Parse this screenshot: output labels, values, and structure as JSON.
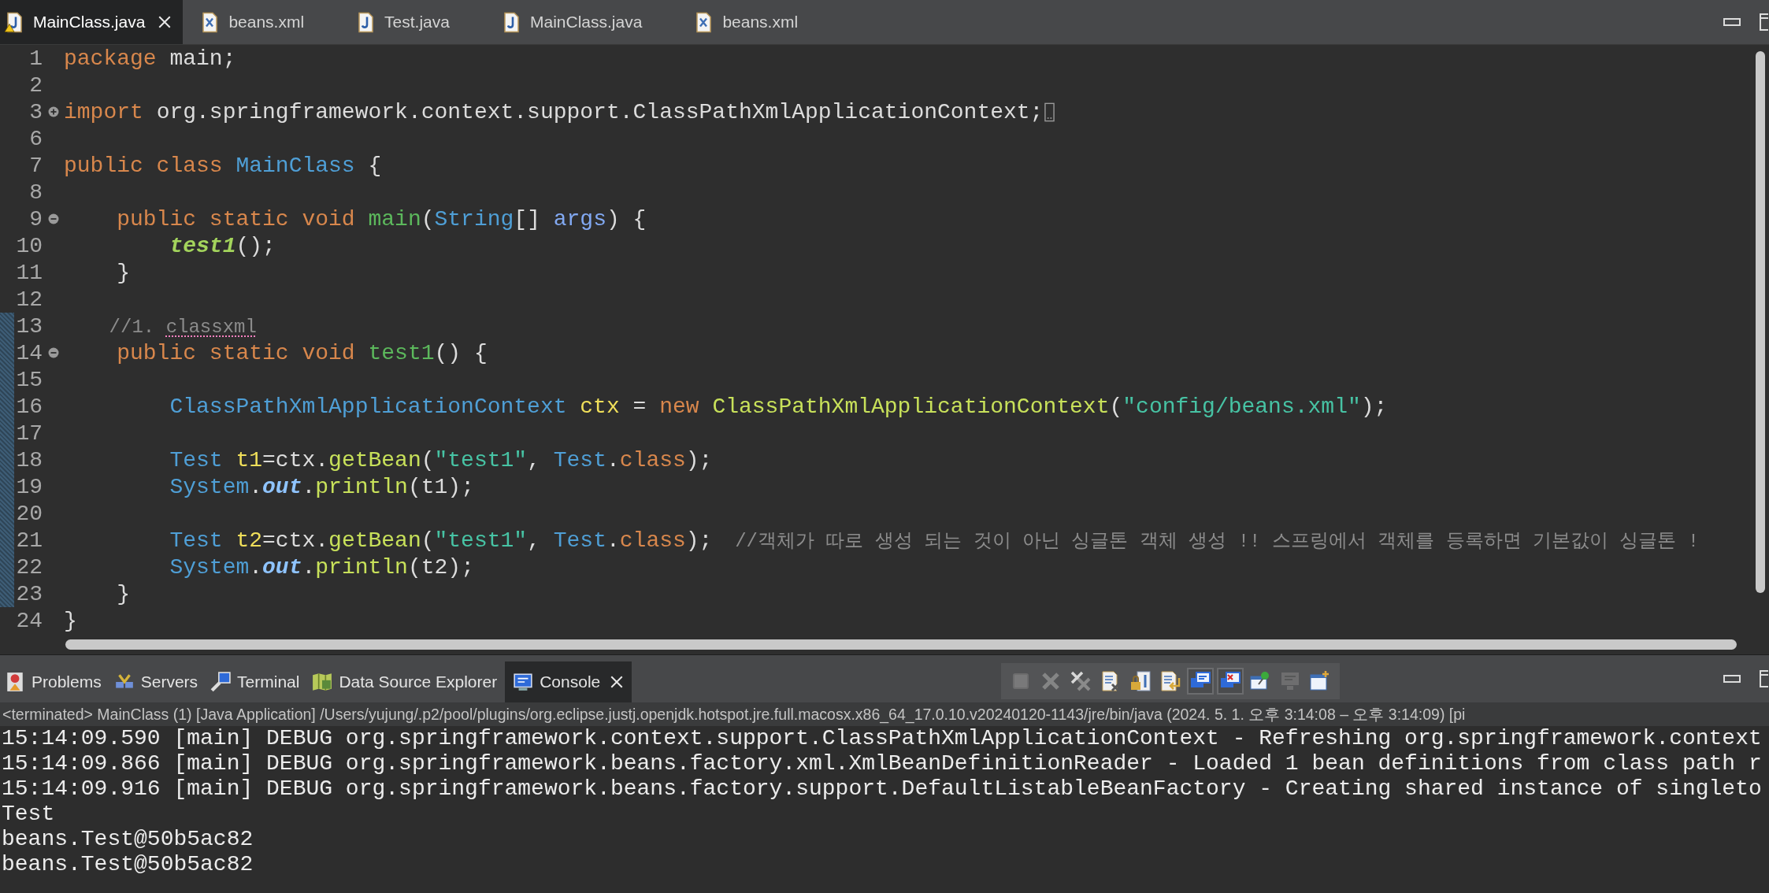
{
  "editor_tabs": [
    {
      "label": "MainClass.java",
      "kind": "java",
      "selected": true,
      "warning": true
    },
    {
      "label": "beans.xml",
      "kind": "xml",
      "selected": false,
      "warning": false
    },
    {
      "label": "Test.java",
      "kind": "java",
      "selected": false,
      "warning": false
    },
    {
      "label": "MainClass.java",
      "kind": "java",
      "selected": false,
      "warning": false
    },
    {
      "label": "beans.xml",
      "kind": "xml",
      "selected": false,
      "warning": false
    }
  ],
  "lines": [
    {
      "number": "1",
      "changed": false,
      "tokens": [
        {
          "kind": "keyword",
          "text": "package"
        },
        {
          "kind": "plain",
          "text": " main;"
        }
      ]
    },
    {
      "number": "2",
      "changed": false
    },
    {
      "number": "3",
      "changed": false,
      "foldable": true,
      "collapsed": true,
      "tokens": [
        {
          "kind": "keyword",
          "text": "import"
        },
        {
          "kind": "plain",
          "text": " org.springframework.context.support.ClassPathXmlApplicationContext;"
        }
      ]
    },
    {
      "number": "6",
      "changed": false
    },
    {
      "number": "7",
      "changed": false,
      "tokens": [
        {
          "kind": "keyword",
          "text": "public class"
        },
        {
          "kind": "type",
          "text": " MainClass"
        },
        {
          "kind": "plain",
          "text": " {"
        }
      ]
    },
    {
      "number": "8",
      "changed": false
    },
    {
      "number": "9",
      "changed": false,
      "foldable": true,
      "collapsed": false,
      "tokens": [
        {
          "kind": "keyword",
          "text": "    public static void "
        },
        {
          "kind": "method",
          "text": "main"
        },
        {
          "kind": "plain",
          "text": "("
        },
        {
          "kind": "type",
          "text": "String"
        },
        {
          "kind": "plain",
          "text": "[] "
        },
        {
          "kind": "param",
          "text": "args"
        },
        {
          "kind": "plain",
          "text": ") {"
        }
      ]
    },
    {
      "number": "10",
      "changed": false,
      "tokens": [
        {
          "kind": "static-call",
          "text": "        test1"
        },
        {
          "kind": "plain",
          "text": "();"
        }
      ]
    },
    {
      "number": "11",
      "changed": false,
      "tokens": [
        {
          "kind": "plain",
          "text": "    }"
        }
      ]
    },
    {
      "number": "12",
      "changed": false
    },
    {
      "number": "13",
      "changed": true,
      "tokens": [
        {
          "kind": "comment",
          "text": "    //1. "
        },
        {
          "kind": "comment",
          "text": "classxml",
          "misspelled": true
        }
      ]
    },
    {
      "number": "14",
      "changed": true,
      "foldable": true,
      "collapsed": false,
      "tokens": [
        {
          "kind": "keyword",
          "text": "    public static void "
        },
        {
          "kind": "method",
          "text": "test1"
        },
        {
          "kind": "plain",
          "text": "() {"
        }
      ]
    },
    {
      "number": "15",
      "changed": true
    },
    {
      "number": "16",
      "changed": true,
      "tokens": [
        {
          "kind": "type",
          "text": "        ClassPathXmlApplicationContext"
        },
        {
          "kind": "local",
          "text": " ctx"
        },
        {
          "kind": "plain",
          "text": " = "
        },
        {
          "kind": "keyword",
          "text": "new"
        },
        {
          "kind": "call",
          "text": " ClassPathXmlApplicationContext"
        },
        {
          "kind": "plain",
          "text": "("
        },
        {
          "kind": "string",
          "text": "\"config/beans.xml\""
        },
        {
          "kind": "plain",
          "text": ");"
        }
      ]
    },
    {
      "number": "17",
      "changed": true
    },
    {
      "number": "18",
      "changed": true,
      "tokens": [
        {
          "kind": "type",
          "text": "        Test"
        },
        {
          "kind": "local",
          "text": " t1"
        },
        {
          "kind": "plain",
          "text": "=ctx."
        },
        {
          "kind": "call",
          "text": "getBean"
        },
        {
          "kind": "plain",
          "text": "("
        },
        {
          "kind": "string",
          "text": "\"test1\""
        },
        {
          "kind": "plain",
          "text": ", "
        },
        {
          "kind": "type",
          "text": "Test"
        },
        {
          "kind": "plain",
          "text": "."
        },
        {
          "kind": "keyword",
          "text": "class"
        },
        {
          "kind": "plain",
          "text": ");"
        }
      ]
    },
    {
      "number": "19",
      "changed": true,
      "tokens": [
        {
          "kind": "type",
          "text": "        System"
        },
        {
          "kind": "plain",
          "text": "."
        },
        {
          "kind": "field",
          "text": "out"
        },
        {
          "kind": "plain",
          "text": "."
        },
        {
          "kind": "call",
          "text": "println"
        },
        {
          "kind": "plain",
          "text": "(t1);"
        }
      ]
    },
    {
      "number": "20",
      "changed": true
    },
    {
      "number": "21",
      "changed": true,
      "tokens": [
        {
          "kind": "type",
          "text": "        Test"
        },
        {
          "kind": "local",
          "text": " t2"
        },
        {
          "kind": "plain",
          "text": "=ctx."
        },
        {
          "kind": "call",
          "text": "getBean"
        },
        {
          "kind": "plain",
          "text": "("
        },
        {
          "kind": "string",
          "text": "\"test1\""
        },
        {
          "kind": "plain",
          "text": ", "
        },
        {
          "kind": "type",
          "text": "Test"
        },
        {
          "kind": "plain",
          "text": "."
        },
        {
          "kind": "keyword",
          "text": "class"
        },
        {
          "kind": "plain",
          "text": ");"
        },
        {
          "kind": "comment",
          "text": "  //객체가 따로 생성 되는 것이 아닌 싱글톤 객체 생성 !! 스프링에서 객체를 등록하면 기본값이 싱글톤 !"
        }
      ]
    },
    {
      "number": "22",
      "changed": true,
      "tokens": [
        {
          "kind": "type",
          "text": "        System"
        },
        {
          "kind": "plain",
          "text": "."
        },
        {
          "kind": "field",
          "text": "out"
        },
        {
          "kind": "plain",
          "text": "."
        },
        {
          "kind": "call",
          "text": "println"
        },
        {
          "kind": "plain",
          "text": "(t2);"
        }
      ]
    },
    {
      "number": "23",
      "changed": true,
      "tokens": [
        {
          "kind": "plain",
          "text": "    }"
        }
      ]
    },
    {
      "number": "24",
      "changed": false,
      "tokens": [
        {
          "kind": "plain",
          "text": "}"
        }
      ]
    }
  ],
  "panel_tabs": [
    {
      "label": "Problems",
      "kind": "problems",
      "selected": false
    },
    {
      "label": "Servers",
      "kind": "servers",
      "selected": false
    },
    {
      "label": "Terminal",
      "kind": "terminal",
      "selected": false
    },
    {
      "label": "Data Source Explorer",
      "kind": "datasource",
      "selected": false
    },
    {
      "label": "Console",
      "kind": "console",
      "selected": true
    }
  ],
  "console_toolbar": [
    {
      "kind": "terminate",
      "disabled": true,
      "pressed": false
    },
    {
      "kind": "remove",
      "disabled": true,
      "pressed": false
    },
    {
      "kind": "remove-all",
      "disabled": false,
      "pressed": false
    },
    {
      "kind": "clear",
      "disabled": false,
      "pressed": false
    },
    {
      "kind": "scroll-lock",
      "disabled": false,
      "pressed": false
    },
    {
      "kind": "word-wrap",
      "disabled": false,
      "pressed": false
    },
    {
      "kind": "show-stdout",
      "disabled": false,
      "pressed": true
    },
    {
      "kind": "show-stderr",
      "disabled": false,
      "pressed": true
    },
    {
      "kind": "pin",
      "disabled": false,
      "pressed": false
    },
    {
      "kind": "display-console",
      "disabled": true,
      "pressed": false
    },
    {
      "kind": "open-console",
      "disabled": false,
      "pressed": false
    }
  ],
  "console": {
    "header": "<terminated> MainClass (1) [Java Application] /Users/yujung/.p2/pool/plugins/org.eclipse.justj.openjdk.hotspot.jre.full.macosx.x86_64_17.0.10.v20240120-1143/jre/bin/java  (2024. 5. 1. 오후 3:14:08 – 오후 3:14:09) [pi",
    "lines": [
      "15:14:09.590 [main] DEBUG org.springframework.context.support.ClassPathXmlApplicationContext - Refreshing org.springframework.context",
      "15:14:09.866 [main] DEBUG org.springframework.beans.factory.xml.XmlBeanDefinitionReader - Loaded 1 bean definitions from class path r",
      "15:14:09.916 [main] DEBUG org.springframework.beans.factory.support.DefaultListableBeanFactory - Creating shared instance of singleto",
      "Test",
      "beans.Test@50b5ac82",
      "beans.Test@50b5ac82"
    ]
  }
}
